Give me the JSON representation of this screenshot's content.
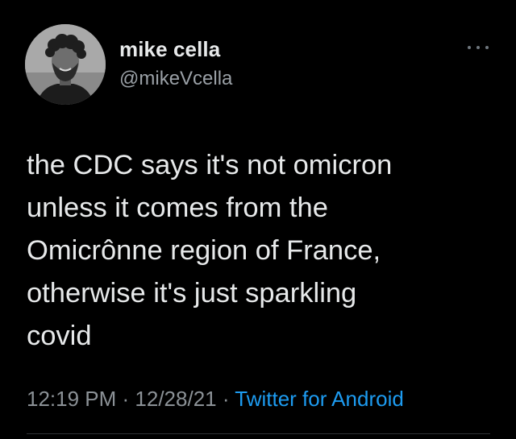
{
  "tweet": {
    "author": {
      "display_name": "mike cella",
      "handle": "@mikeVcella",
      "avatar": "profile-photo"
    },
    "more_icon": "ellipsis-icon",
    "text": "the CDC says it's not omicron\nunless it comes from the\nOmicrônne region of France,\notherwise it's just sparkling\ncovid",
    "time": "12:19 PM",
    "separator": " · ",
    "date": "12/28/21",
    "source": "Twitter for Android"
  },
  "colors": {
    "background": "#000000",
    "primary_text": "#e7e9ea",
    "secondary_text": "#8b9196",
    "accent": "#1d9bf0"
  }
}
